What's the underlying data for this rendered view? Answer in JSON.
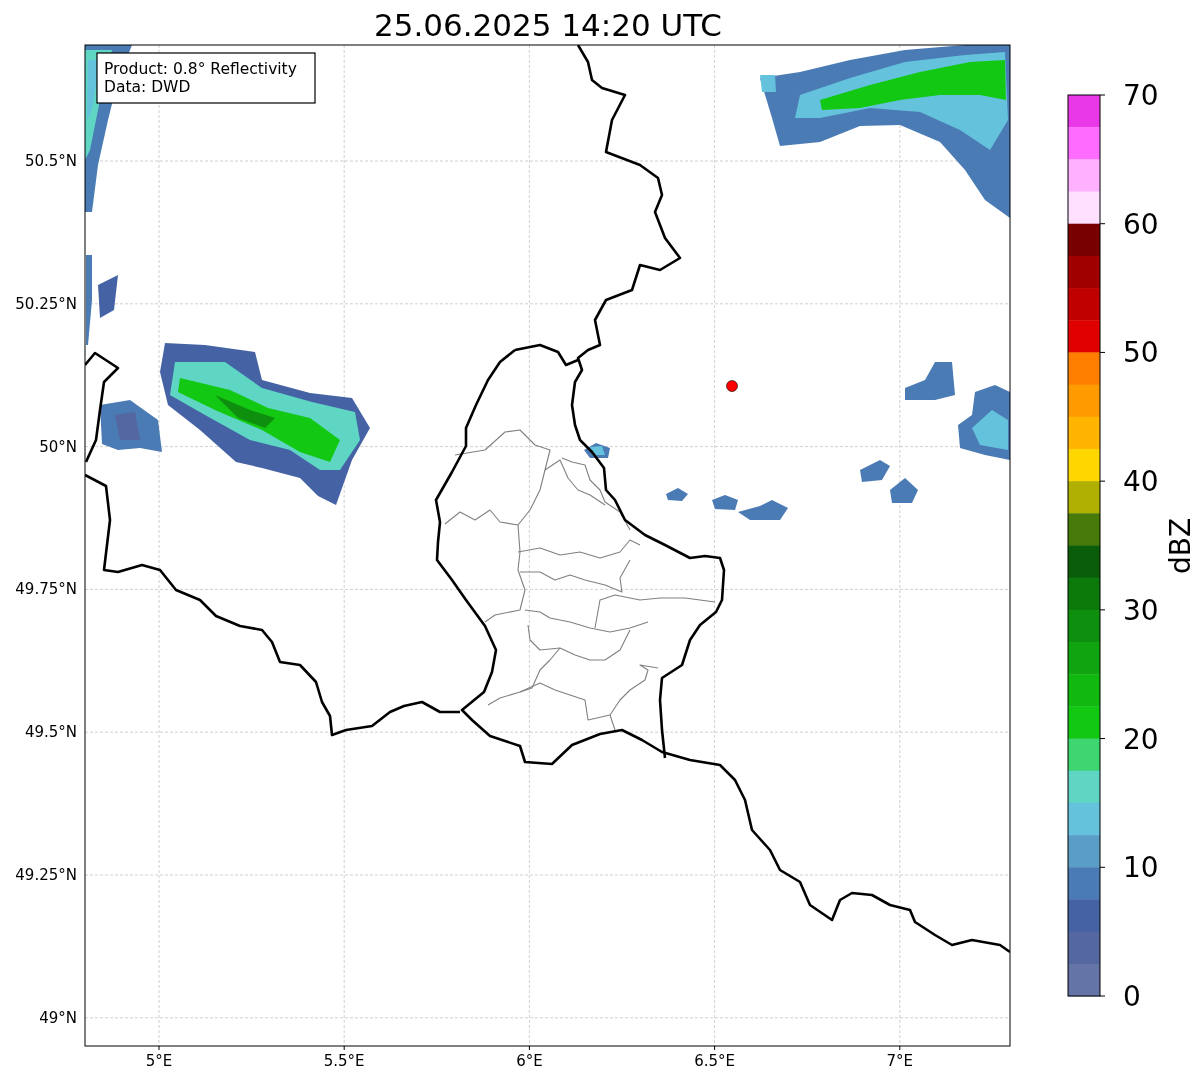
{
  "title": "25.06.2025 14:20 UTC",
  "info_box": [
    "Product: 0.8° Reflectivity",
    "Data: DWD"
  ],
  "map": {
    "xticks": [
      "5°E",
      "5.5°E",
      "6°E",
      "6.5°E",
      "7°E"
    ],
    "yticks": [
      "50.5°N",
      "50.25°N",
      "50°N",
      "49.75°N",
      "49.5°N",
      "49.25°N",
      "49°N"
    ]
  },
  "colorbar": {
    "label": "dBZ",
    "ticks": [
      "70",
      "60",
      "50",
      "40",
      "30",
      "20",
      "10",
      "0"
    ],
    "bins": [
      {
        "color": "#e838e8"
      },
      {
        "color": "#ff6cff"
      },
      {
        "color": "#ffb0ff"
      },
      {
        "color": "#ffe0ff"
      },
      {
        "color": "#780000"
      },
      {
        "color": "#a00000"
      },
      {
        "color": "#c00000"
      },
      {
        "color": "#e00000"
      },
      {
        "color": "#ff7e00"
      },
      {
        "color": "#ff9a00"
      },
      {
        "color": "#ffb400"
      },
      {
        "color": "#ffd700"
      },
      {
        "color": "#b0b000"
      },
      {
        "color": "#487a0a"
      },
      {
        "color": "#0a5e0a"
      },
      {
        "color": "#0b7a0b"
      },
      {
        "color": "#0e900e"
      },
      {
        "color": "#10a410"
      },
      {
        "color": "#10b810"
      },
      {
        "color": "#12c812"
      },
      {
        "color": "#3dd670"
      },
      {
        "color": "#5fd6c4"
      },
      {
        "color": "#64c2dc"
      },
      {
        "color": "#5a9ec8"
      },
      {
        "color": "#4a7bb4"
      },
      {
        "color": "#4562a4"
      },
      {
        "color": "#5467a0"
      },
      {
        "color": "#6474a6"
      }
    ]
  }
}
